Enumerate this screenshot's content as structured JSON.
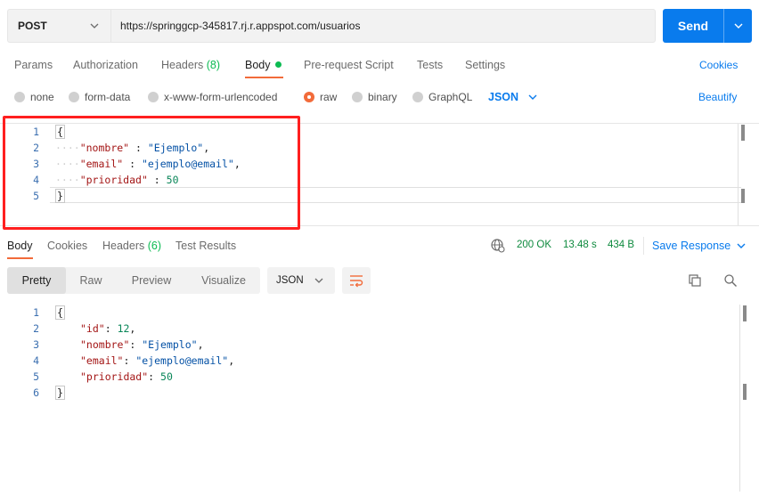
{
  "request": {
    "method": "POST",
    "url": "https://springgcp-345817.rj.r.appspot.com/usuarios",
    "send_label": "Send"
  },
  "request_tabs": [
    {
      "label": "Params"
    },
    {
      "label": "Authorization"
    },
    {
      "label": "Headers",
      "count": "(8)"
    },
    {
      "label": "Body"
    },
    {
      "label": "Pre-request Script"
    },
    {
      "label": "Tests"
    },
    {
      "label": "Settings"
    }
  ],
  "cookies_label": "Cookies",
  "body_types": [
    "none",
    "form-data",
    "x-www-form-urlencoded",
    "raw",
    "binary",
    "GraphQL"
  ],
  "selected_body_type": "raw",
  "body_format": "JSON",
  "beautify_label": "Beautify",
  "request_body": {
    "line_numbers": [
      "1",
      "2",
      "3",
      "4",
      "5"
    ],
    "open": "{",
    "close": "}",
    "fields": [
      {
        "key": "\"nombre\"",
        "sep": " : ",
        "value": "\"Ejemplo\"",
        "trail": ","
      },
      {
        "key": "\"email\"",
        "sep": " : ",
        "value": "\"ejemplo@email\"",
        "trail": ","
      },
      {
        "key": "\"prioridad\"",
        "sep": " : ",
        "value": "50",
        "trail": ""
      }
    ]
  },
  "response_tabs": [
    {
      "label": "Body"
    },
    {
      "label": "Cookies"
    },
    {
      "label": "Headers",
      "count": "(6)"
    },
    {
      "label": "Test Results"
    }
  ],
  "response_status": {
    "status": "200 OK",
    "time": "13.48 s",
    "size": "434 B",
    "save_label": "Save Response"
  },
  "view_modes": [
    "Pretty",
    "Raw",
    "Preview",
    "Visualize"
  ],
  "response_format": "JSON",
  "response_body": {
    "line_numbers": [
      "1",
      "2",
      "3",
      "4",
      "5",
      "6"
    ],
    "open": "{",
    "close": "}",
    "fields": [
      {
        "key": "\"id\"",
        "sep": ": ",
        "value": "12",
        "trail": ","
      },
      {
        "key": "\"nombre\"",
        "sep": ": ",
        "value": "\"Ejemplo\"",
        "trail": ","
      },
      {
        "key": "\"email\"",
        "sep": ": ",
        "value": "\"ejemplo@email\"",
        "trail": ","
      },
      {
        "key": "\"prioridad\"",
        "sep": ": ",
        "value": "50",
        "trail": ""
      }
    ]
  },
  "colors": {
    "accent": "#097bed",
    "active_tab": "#f26b3a",
    "success": "#0cbb52",
    "highlight": "#ff1f1f"
  },
  "icons": [
    "chevron-down-icon",
    "globe-icon",
    "copy-icon",
    "search-icon",
    "wrap-lines-icon"
  ]
}
